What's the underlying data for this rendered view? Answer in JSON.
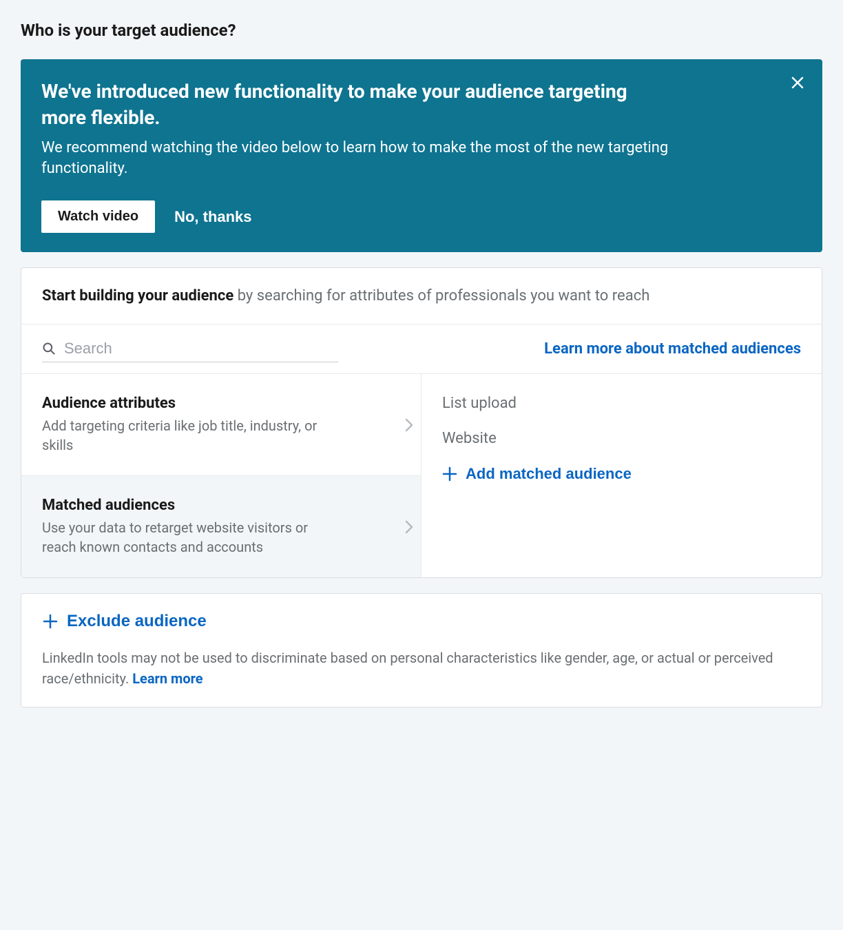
{
  "page": {
    "title": "Who is your target audience?"
  },
  "banner": {
    "title": "We've introduced new functionality to make your audience targeting more flexible.",
    "description": "We recommend watching the video below to learn how to make the most of the new targeting functionality.",
    "primary_button": "Watch video",
    "dismiss_button": "No, thanks"
  },
  "builder": {
    "header_bold": "Start building your audience",
    "header_light": " by searching for attributes of professionals you want to reach",
    "search_placeholder": "Search",
    "learn_more_link": "Learn more about matched audiences",
    "options": [
      {
        "title": "Audience attributes",
        "description": "Add targeting criteria like job title, industry, or skills",
        "selected": false
      },
      {
        "title": "Matched audiences",
        "description": "Use your data to retarget website visitors or reach known contacts and accounts",
        "selected": true
      }
    ],
    "matched_subitems": [
      "List upload",
      "Website"
    ],
    "add_matched_label": "Add matched audience"
  },
  "exclude": {
    "button_label": "Exclude audience",
    "disclaimer_text": "LinkedIn tools may not be used to discriminate based on personal characteristics like gender, age, or actual or perceived race/ethnicity. ",
    "disclaimer_link": "Learn more"
  }
}
